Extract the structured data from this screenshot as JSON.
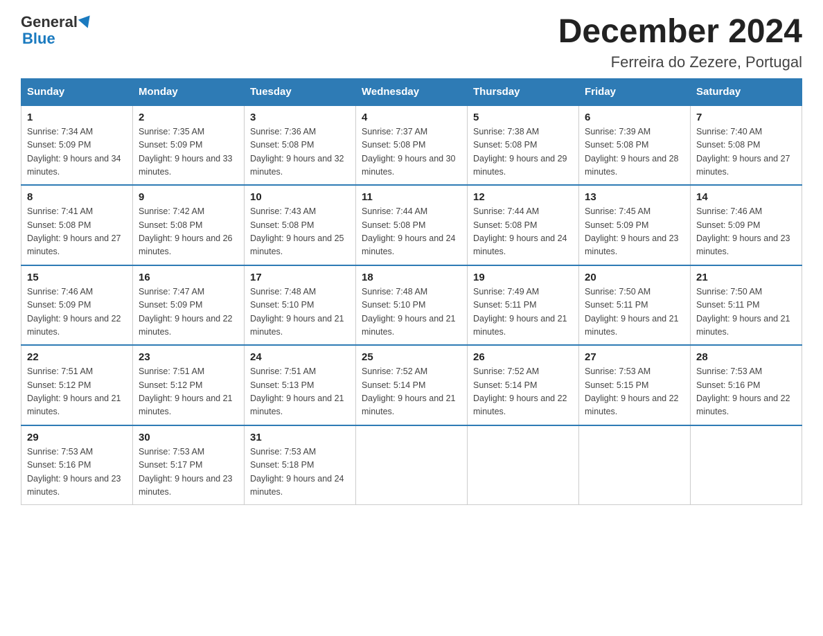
{
  "header": {
    "logo_line1": "General",
    "logo_line2": "Blue",
    "title": "December 2024",
    "subtitle": "Ferreira do Zezere, Portugal"
  },
  "days_of_week": [
    "Sunday",
    "Monday",
    "Tuesday",
    "Wednesday",
    "Thursday",
    "Friday",
    "Saturday"
  ],
  "weeks": [
    [
      {
        "day": "1",
        "sunrise": "7:34 AM",
        "sunset": "5:09 PM",
        "daylight": "9 hours and 34 minutes."
      },
      {
        "day": "2",
        "sunrise": "7:35 AM",
        "sunset": "5:09 PM",
        "daylight": "9 hours and 33 minutes."
      },
      {
        "day": "3",
        "sunrise": "7:36 AM",
        "sunset": "5:08 PM",
        "daylight": "9 hours and 32 minutes."
      },
      {
        "day": "4",
        "sunrise": "7:37 AM",
        "sunset": "5:08 PM",
        "daylight": "9 hours and 30 minutes."
      },
      {
        "day": "5",
        "sunrise": "7:38 AM",
        "sunset": "5:08 PM",
        "daylight": "9 hours and 29 minutes."
      },
      {
        "day": "6",
        "sunrise": "7:39 AM",
        "sunset": "5:08 PM",
        "daylight": "9 hours and 28 minutes."
      },
      {
        "day": "7",
        "sunrise": "7:40 AM",
        "sunset": "5:08 PM",
        "daylight": "9 hours and 27 minutes."
      }
    ],
    [
      {
        "day": "8",
        "sunrise": "7:41 AM",
        "sunset": "5:08 PM",
        "daylight": "9 hours and 27 minutes."
      },
      {
        "day": "9",
        "sunrise": "7:42 AM",
        "sunset": "5:08 PM",
        "daylight": "9 hours and 26 minutes."
      },
      {
        "day": "10",
        "sunrise": "7:43 AM",
        "sunset": "5:08 PM",
        "daylight": "9 hours and 25 minutes."
      },
      {
        "day": "11",
        "sunrise": "7:44 AM",
        "sunset": "5:08 PM",
        "daylight": "9 hours and 24 minutes."
      },
      {
        "day": "12",
        "sunrise": "7:44 AM",
        "sunset": "5:08 PM",
        "daylight": "9 hours and 24 minutes."
      },
      {
        "day": "13",
        "sunrise": "7:45 AM",
        "sunset": "5:09 PM",
        "daylight": "9 hours and 23 minutes."
      },
      {
        "day": "14",
        "sunrise": "7:46 AM",
        "sunset": "5:09 PM",
        "daylight": "9 hours and 23 minutes."
      }
    ],
    [
      {
        "day": "15",
        "sunrise": "7:46 AM",
        "sunset": "5:09 PM",
        "daylight": "9 hours and 22 minutes."
      },
      {
        "day": "16",
        "sunrise": "7:47 AM",
        "sunset": "5:09 PM",
        "daylight": "9 hours and 22 minutes."
      },
      {
        "day": "17",
        "sunrise": "7:48 AM",
        "sunset": "5:10 PM",
        "daylight": "9 hours and 21 minutes."
      },
      {
        "day": "18",
        "sunrise": "7:48 AM",
        "sunset": "5:10 PM",
        "daylight": "9 hours and 21 minutes."
      },
      {
        "day": "19",
        "sunrise": "7:49 AM",
        "sunset": "5:11 PM",
        "daylight": "9 hours and 21 minutes."
      },
      {
        "day": "20",
        "sunrise": "7:50 AM",
        "sunset": "5:11 PM",
        "daylight": "9 hours and 21 minutes."
      },
      {
        "day": "21",
        "sunrise": "7:50 AM",
        "sunset": "5:11 PM",
        "daylight": "9 hours and 21 minutes."
      }
    ],
    [
      {
        "day": "22",
        "sunrise": "7:51 AM",
        "sunset": "5:12 PM",
        "daylight": "9 hours and 21 minutes."
      },
      {
        "day": "23",
        "sunrise": "7:51 AM",
        "sunset": "5:12 PM",
        "daylight": "9 hours and 21 minutes."
      },
      {
        "day": "24",
        "sunrise": "7:51 AM",
        "sunset": "5:13 PM",
        "daylight": "9 hours and 21 minutes."
      },
      {
        "day": "25",
        "sunrise": "7:52 AM",
        "sunset": "5:14 PM",
        "daylight": "9 hours and 21 minutes."
      },
      {
        "day": "26",
        "sunrise": "7:52 AM",
        "sunset": "5:14 PM",
        "daylight": "9 hours and 22 minutes."
      },
      {
        "day": "27",
        "sunrise": "7:53 AM",
        "sunset": "5:15 PM",
        "daylight": "9 hours and 22 minutes."
      },
      {
        "day": "28",
        "sunrise": "7:53 AM",
        "sunset": "5:16 PM",
        "daylight": "9 hours and 22 minutes."
      }
    ],
    [
      {
        "day": "29",
        "sunrise": "7:53 AM",
        "sunset": "5:16 PM",
        "daylight": "9 hours and 23 minutes."
      },
      {
        "day": "30",
        "sunrise": "7:53 AM",
        "sunset": "5:17 PM",
        "daylight": "9 hours and 23 minutes."
      },
      {
        "day": "31",
        "sunrise": "7:53 AM",
        "sunset": "5:18 PM",
        "daylight": "9 hours and 24 minutes."
      },
      null,
      null,
      null,
      null
    ]
  ]
}
